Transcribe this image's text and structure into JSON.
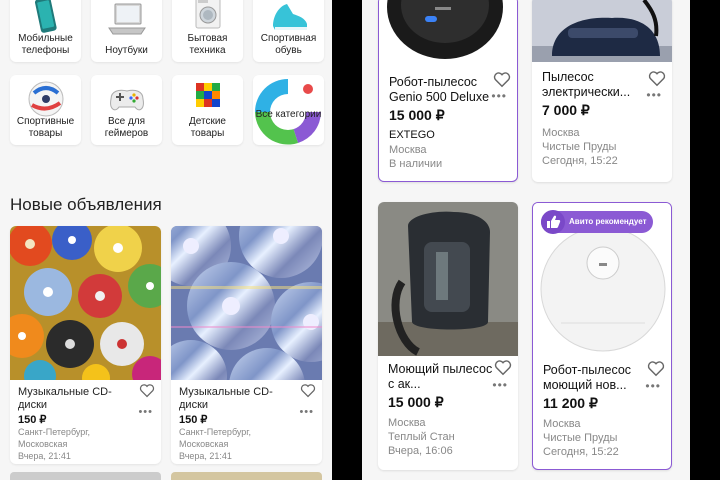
{
  "left": {
    "categories": [
      {
        "label": "Мобильные телефоны",
        "icon": "smartphone-icon"
      },
      {
        "label": "Ноутбуки",
        "icon": "laptop-icon"
      },
      {
        "label": "Бытовая техника",
        "icon": "washing-machine-icon"
      },
      {
        "label": "Спортивная обувь",
        "icon": "sneaker-icon"
      },
      {
        "label": "Спортивные товары",
        "icon": "soccer-ball-icon"
      },
      {
        "label": "Все для геймеров",
        "icon": "gamepad-icon"
      },
      {
        "label": "Детские товары",
        "icon": "rubiks-cube-icon"
      },
      {
        "label": "Все категории",
        "icon": "all-categories-icon"
      }
    ],
    "section_title": "Новые объявления",
    "ads": [
      {
        "title": "Музыкальные CD-диски",
        "price": "150 ₽",
        "location": "Санкт-Петербург, Московская",
        "date": "Вчера, 21:41"
      },
      {
        "title": "Музыкальные CD-диски",
        "price": "150 ₽",
        "location": "Санкт-Петербург, Московская",
        "date": "Вчера, 21:41"
      }
    ]
  },
  "right": {
    "ads": [
      {
        "title": "Робот-пылесос Genio 500 Deluxe",
        "price": "15 000 ₽",
        "seller": "EXTEGO",
        "city": "Москва",
        "status": "В наличии"
      },
      {
        "title": "Пылесос электрически...",
        "price": "7 000 ₽",
        "city": "Москва",
        "area": "Чистые Пруды",
        "date": "Сегодня, 15:22"
      },
      {
        "title": "Моющий пылесос с ак...",
        "price": "15 000 ₽",
        "city": "Москва",
        "area": "Теплый Стан",
        "date": "Вчера, 16:06"
      },
      {
        "title": "Робот-пылесос моющий нов...",
        "price": "11 200 ₽",
        "city": "Москва",
        "area": "Чистые Пруды",
        "date": "Сегодня, 15:22",
        "badge": "Авито рекомендует"
      }
    ]
  },
  "colors": {
    "accent": "#8b5ad4"
  }
}
